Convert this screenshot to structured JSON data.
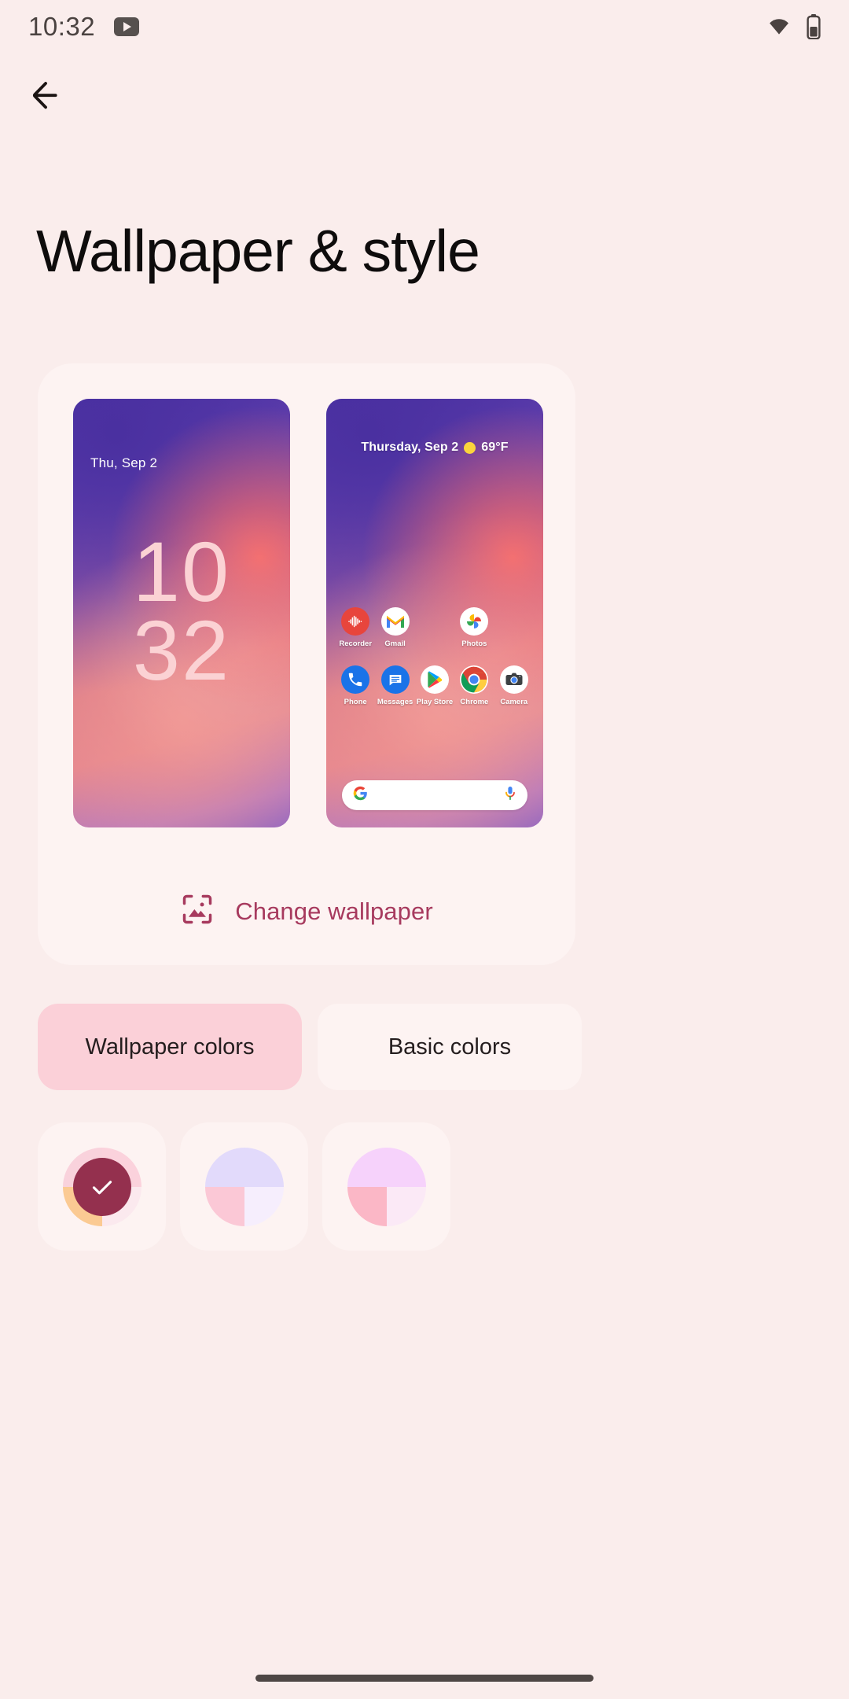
{
  "statusbar": {
    "time": "10:32",
    "icons": [
      "youtube-icon",
      "wifi-icon",
      "battery-icon"
    ]
  },
  "navigation": {
    "back_icon": "arrow-left-icon",
    "back_label": "Back"
  },
  "header": {
    "title": "Wallpaper & style"
  },
  "preview": {
    "lock_screen": {
      "date": "Thu, Sep 2",
      "clock_hours": "10",
      "clock_minutes": "32"
    },
    "home_screen": {
      "weather_date": "Thursday, Sep 2",
      "weather_icon": "sun-icon",
      "weather_temp": "69°F",
      "apps_row1": [
        {
          "label": "Recorder",
          "icon": "recorder-icon"
        },
        {
          "label": "Gmail",
          "icon": "gmail-icon"
        },
        {
          "label": "",
          "icon": "empty-slot"
        },
        {
          "label": "Photos",
          "icon": "photos-icon"
        },
        {
          "label": "",
          "icon": "empty-slot"
        }
      ],
      "apps_row2": [
        {
          "label": "Phone",
          "icon": "phone-icon"
        },
        {
          "label": "Messages",
          "icon": "messages-icon"
        },
        {
          "label": "Play Store",
          "icon": "play-store-icon"
        },
        {
          "label": "Chrome",
          "icon": "chrome-icon"
        },
        {
          "label": "Camera",
          "icon": "camera-icon"
        }
      ],
      "search": {
        "left_icon": "google-g-icon",
        "right_icon": "microphone-icon",
        "placeholder": ""
      }
    },
    "change_wallpaper": {
      "icon": "image-frame-icon",
      "label": "Change wallpaper",
      "color": "#A73A5E"
    }
  },
  "color_tabs": [
    {
      "label": "Wallpaper colors",
      "selected": true,
      "bg": "#FBD0D8"
    },
    {
      "label": "Basic colors",
      "selected": false,
      "bg": "#FDF3F2"
    }
  ],
  "color_swatches": [
    {
      "name": "swatch-1",
      "selected": true,
      "check_icon": "check-icon",
      "check_bg": "#94304E",
      "quadrants": [
        "#F9D2DC",
        "#FBD2DC",
        "#FBCA93",
        "#FBE9EE"
      ]
    },
    {
      "name": "swatch-2",
      "selected": false,
      "quadrants": [
        "#E2DAFB",
        "#E2DAFB",
        "#FBC8D6",
        "#F6EEFD"
      ]
    },
    {
      "name": "swatch-3",
      "selected": false,
      "quadrants": [
        "#F6D2FB",
        "#F6D2FB",
        "#FBB7C6",
        "#FBE9F6"
      ]
    }
  ],
  "navbar": {
    "gesture_pill": "home-gesture-pill"
  },
  "theme": {
    "page_bg": "#FAEDEC",
    "card_bg": "#FDF3F2",
    "accent": "#A73A5E",
    "text": "#0E0C0C"
  }
}
